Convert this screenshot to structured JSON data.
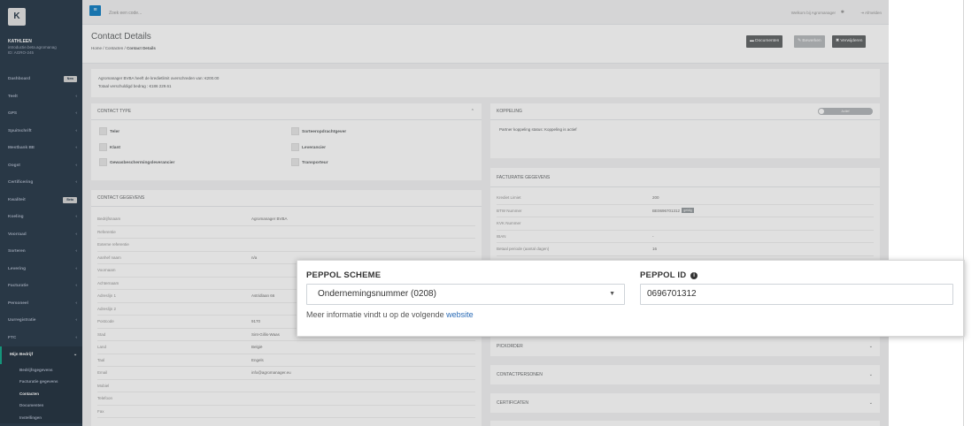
{
  "topbar": {
    "search_placeholder": "Zoek een code...",
    "welcome": "Welkom bij Agromanager",
    "logout": "Afmelden"
  },
  "sidebar": {
    "logo_letter": "K",
    "user_name": "KATHLEEN",
    "user_sub": "introductie.beta.agromanag",
    "user_id": "ID: AGRO-245",
    "items": [
      {
        "label": "Dashboard",
        "badge": "New"
      },
      {
        "label": "Teelt"
      },
      {
        "label": "GPS"
      },
      {
        "label": "Spuitschrift"
      },
      {
        "label": "Mestbank BE"
      },
      {
        "label": "Oogst"
      },
      {
        "label": "Certificering"
      },
      {
        "label": "Kwaliteit",
        "badge": "Beta"
      },
      {
        "label": "Koeling"
      },
      {
        "label": "Voorraad"
      },
      {
        "label": "Sorteren"
      },
      {
        "label": "Levering"
      },
      {
        "label": "Facturatie"
      },
      {
        "label": "Personeel"
      },
      {
        "label": "Uurregistratie"
      },
      {
        "label": "FTC"
      },
      {
        "label": "Mijn Bedrijf"
      }
    ],
    "subitems": [
      "Bedrijfsgegevens",
      "Facturatie gegevens",
      "Contacten",
      "Documenten",
      "Instellingen"
    ]
  },
  "header": {
    "title": "Contact Details",
    "crumb_home": "Home",
    "crumb_contacts": "Contacten",
    "crumb_current": "Contact Details",
    "btn_documents": "Documenten",
    "btn_edit": "Bewerken",
    "btn_delete": "Verwijderen"
  },
  "notice": {
    "line1": "Agromanager BVBA heeft de kredietlimit overschreden van: €200.00",
    "line2": "Totaal verschuldigd bedrag : €186 229.61"
  },
  "contact_type": {
    "title": "CONTACT TYPE",
    "options": [
      "Teler",
      "Sorteeropdrachtgever",
      "Klant",
      "Leverancier",
      "Gewasbeschermingsleverancier",
      "Transporteur"
    ]
  },
  "koppeling": {
    "title": "KOPPELING",
    "toggle_label": "Actief",
    "status_text": "Partner koppeling status: Koppeling is actief"
  },
  "contact_gegevens": {
    "title": "CONTACT GEGEVENS",
    "rows": [
      {
        "label": "Bedrijfsnaam",
        "value": "Agromanager BVBA"
      },
      {
        "label": "Referentie",
        "value": ""
      },
      {
        "label": "Externe referentie",
        "value": ""
      },
      {
        "label": "Aanhef naam",
        "value": "n/a"
      },
      {
        "label": "Voornaam",
        "value": ""
      },
      {
        "label": "Achternaam",
        "value": ""
      },
      {
        "label": "Adreslijn 1",
        "value": "Astridlaan 66"
      },
      {
        "label": "Adreslijn 2",
        "value": ""
      },
      {
        "label": "Postcode",
        "value": "9170"
      },
      {
        "label": "Stad",
        "value": "Sint-Gillis-Waas"
      },
      {
        "label": "Land",
        "value": "België"
      },
      {
        "label": "Taal",
        "value": "Engels"
      },
      {
        "label": "Email",
        "value": "info@agromanager.eu"
      },
      {
        "label": "Mobiel",
        "value": ""
      },
      {
        "label": "Telefoon",
        "value": ""
      },
      {
        "label": "Fax",
        "value": ""
      }
    ]
  },
  "facturatie": {
    "title": "FACTURATIE GEGEVENS",
    "rows": [
      {
        "label": "Krediet Limiet",
        "value": "200"
      },
      {
        "label": "BTW Nummer",
        "value": "BE0696701312",
        "tag": "geldig"
      },
      {
        "label": "KVK Nummer",
        "value": ""
      },
      {
        "label": "IBAN",
        "value": "-"
      },
      {
        "label": "Betaal periode (aantal dagen)",
        "value": "16"
      }
    ]
  },
  "collapsed_sections": [
    "PICKORDER",
    "CONTACTPERSONEN",
    "CERTIFICATEN"
  ],
  "peppol": {
    "scheme_label": "PEPPOL SCHEME",
    "scheme_value": "Ondernemingsnummer (0208)",
    "id_label": "PEPPOL ID",
    "id_value": "0696701312",
    "more_text": "Meer informatie vindt u op de volgende",
    "more_link": "website"
  },
  "colors": {
    "sidebar": "#2f4050",
    "accent": "#19aa8d",
    "link": "#2a6bb6",
    "primary_button": "#1c84c6"
  }
}
